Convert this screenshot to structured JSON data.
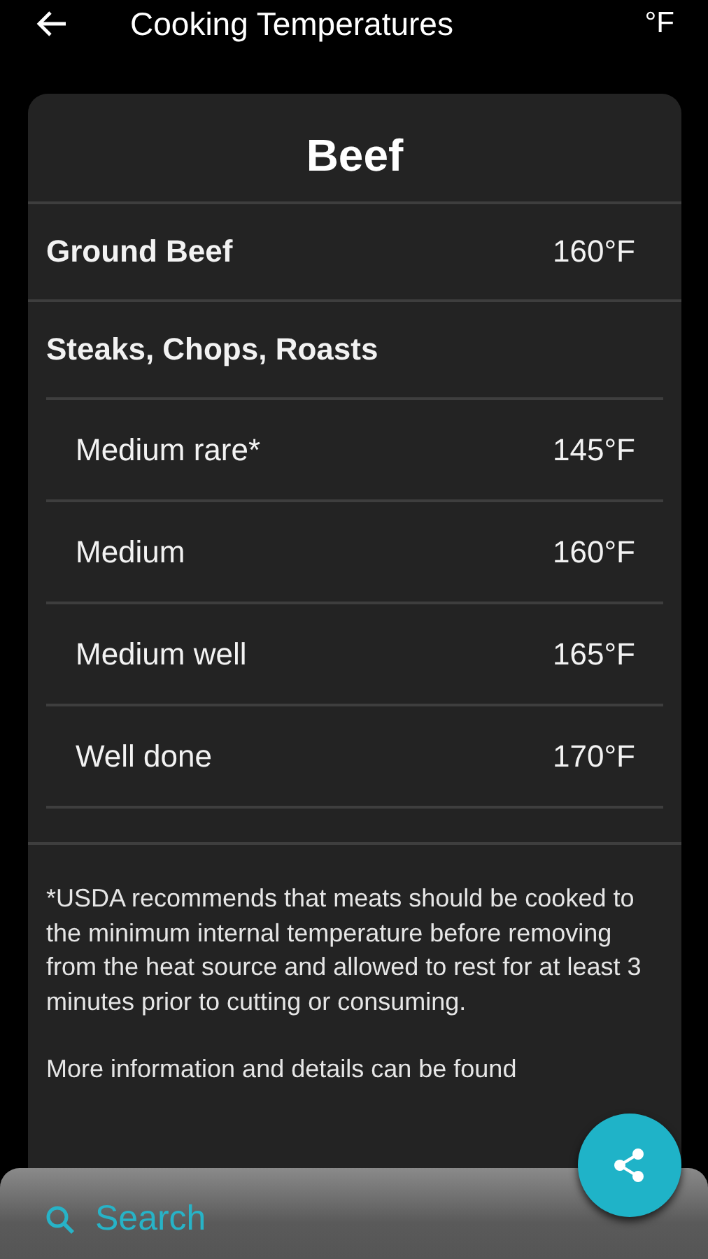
{
  "app_bar": {
    "title": "Cooking Temperatures",
    "unit": "°F"
  },
  "card": {
    "title": "Beef",
    "entries": [
      {
        "label": "Ground Beef",
        "temp": "160°F"
      },
      {
        "label": "Steaks, Chops, Roasts",
        "children": [
          {
            "label": "Medium rare*",
            "temp": "145°F"
          },
          {
            "label": "Medium",
            "temp": "160°F"
          },
          {
            "label": "Medium well",
            "temp": "165°F"
          },
          {
            "label": "Well done",
            "temp": "170°F"
          }
        ]
      }
    ],
    "notes": [
      "*USDA recommends that meats should be cooked to the minimum internal temperature before removing from the heat source and allowed to rest for at least 3 minutes prior to cutting or consuming.",
      "More information and details can be found"
    ]
  },
  "bottom_bar": {
    "search_label": "Search"
  }
}
